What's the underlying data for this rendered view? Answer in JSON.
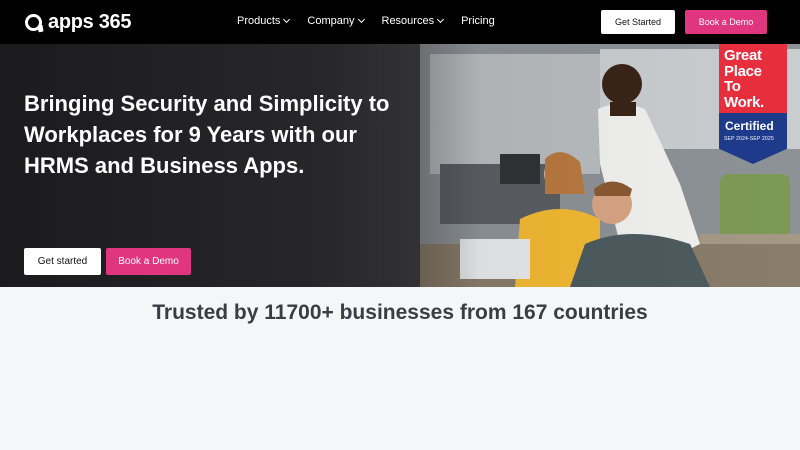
{
  "nav": {
    "logo_text": "apps 365",
    "menu": [
      {
        "label": "Products"
      },
      {
        "label": "Company"
      },
      {
        "label": "Resources"
      },
      {
        "label": "Pricing"
      }
    ],
    "get_started": "Get Started",
    "book_demo": "Book a Demo"
  },
  "hero": {
    "title": "Bringing Security and Simplicity to Workplaces for 9 Years with our HRMS and Business Apps.",
    "get_started": "Get started",
    "book_demo": "Book a Demo",
    "badge": {
      "line1": "Great",
      "line2": "Place",
      "line3": "To",
      "line4": "Work.",
      "certified": "Certified",
      "dates": "SEP 2024-SEP 2025"
    }
  },
  "trust": {
    "title": "Trusted by 11700+ businesses from 167 countries"
  },
  "colors": {
    "accent": "#e0357f",
    "nav_bg": "#000000",
    "badge_red": "#e62e3d",
    "badge_blue": "#1e3a8a"
  }
}
